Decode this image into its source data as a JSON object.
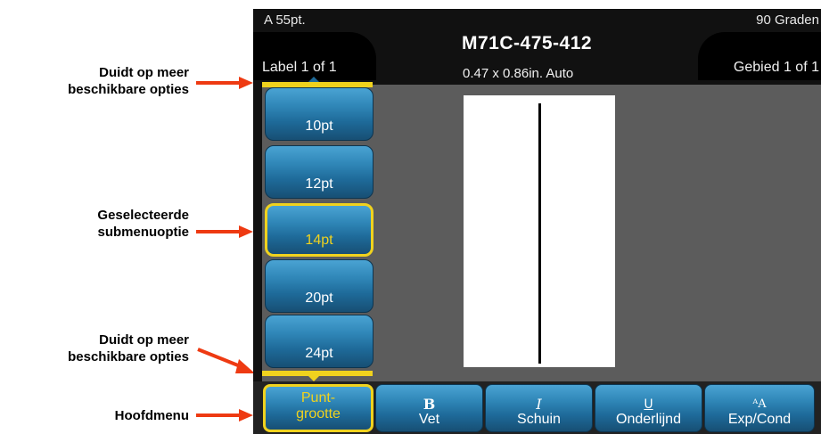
{
  "callouts": {
    "more_top": {
      "line1": "Duidt op meer",
      "line2": "beschikbare opties"
    },
    "selected": {
      "line1": "Geselecteerde",
      "line2": "submenuoptie"
    },
    "more_bottom": {
      "line1": "Duidt op meer",
      "line2": "beschikbare opties"
    },
    "main_menu": {
      "line1": "Hoofdmenu"
    }
  },
  "status": {
    "font_size": "A 55pt.",
    "rotation": "90 Graden"
  },
  "header": {
    "label_counter": "Label 1 of 1",
    "area_counter": "Gebied 1 of 1",
    "label_name": "M71C-475-412",
    "label_size": "0.47 x 0.86in.  Auto"
  },
  "submenu": {
    "items": [
      {
        "label": "10pt",
        "selected": false
      },
      {
        "label": "12pt",
        "selected": false
      },
      {
        "label": "14pt",
        "selected": true
      },
      {
        "label": "20pt",
        "selected": false
      },
      {
        "label": "24pt",
        "selected": false
      }
    ]
  },
  "main_menu": {
    "items": [
      {
        "icon": "",
        "label_line1": "Punt-",
        "label_line2": "grootte",
        "selected": true
      },
      {
        "icon": "B",
        "label": "Vet"
      },
      {
        "icon": "I",
        "label": "Schuin"
      },
      {
        "icon": "U",
        "label": "Onderlijnd"
      },
      {
        "icon": "ᴬA",
        "label": "Exp/Cond"
      }
    ]
  },
  "colors": {
    "accent_yellow": "#f0d21e",
    "button_blue": "#2f86b7",
    "arrow_red": "#ee3a12",
    "edit_area_gray": "#5c5c5c"
  }
}
